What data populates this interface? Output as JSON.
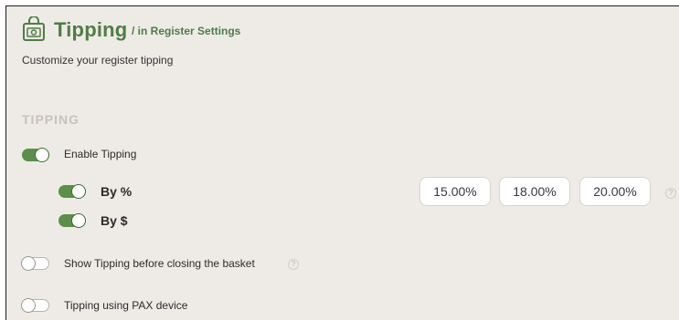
{
  "header": {
    "title": "Tipping",
    "breadcrumb": "/ in Register Settings",
    "subtitle": "Customize your register tipping",
    "icon": "register-bag-icon"
  },
  "section": {
    "heading": "TIPPING"
  },
  "settings": {
    "enable_tipping": {
      "label": "Enable Tipping",
      "on": true
    },
    "by_percent": {
      "label": "By %",
      "on": true
    },
    "by_dollar": {
      "label": "By $",
      "on": true
    },
    "show_before_closing": {
      "label": "Show Tipping before closing the basket",
      "on": false
    },
    "pax_device": {
      "label": "Tipping using PAX device",
      "on": false
    }
  },
  "tip_percentages": [
    "15.00%",
    "18.00%",
    "20.00%"
  ],
  "help_icon_glyph": "?",
  "colors": {
    "accent": "#4f7d45",
    "toggle_on": "#5b8f4a",
    "background": "#eeebe7"
  }
}
